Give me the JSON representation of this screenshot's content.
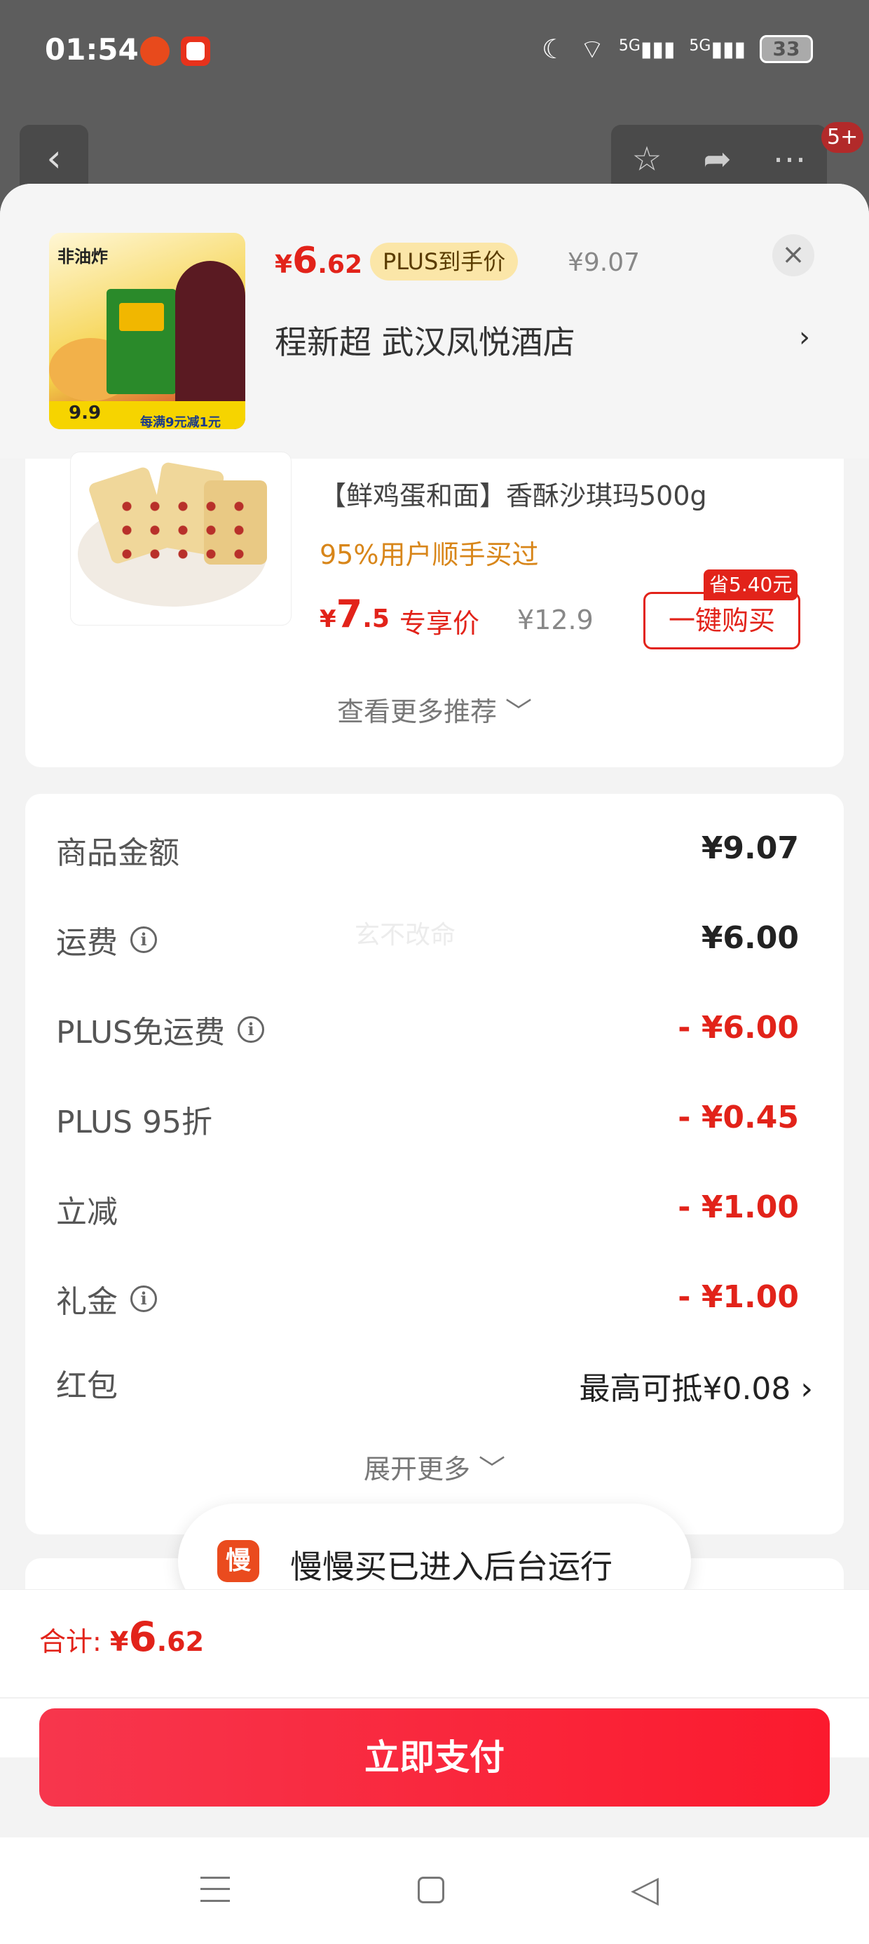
{
  "status_bar": {
    "time": "01:54",
    "battery": "33",
    "network": [
      "5G",
      "5G"
    ],
    "icons": [
      "moon-icon",
      "wifi-icon",
      "signal-icon",
      "signal-icon"
    ]
  },
  "background": {
    "badge": "5+"
  },
  "header": {
    "price_symbol": "¥",
    "price_int": "6",
    "price_dec": ".62",
    "plus_tag": "PLUS到手价",
    "original_price": "¥9.07",
    "close_label": "×",
    "hotel": "程新超  武汉凤悦酒店",
    "arrow": "›",
    "thumb_title": "非油炸",
    "thumb_price": "9.9",
    "thumb_promo": "每满9元减1元"
  },
  "recommendation": {
    "title": "【鲜鸡蛋和面】香酥沙琪玛500g",
    "social_proof": "95%用户顺手买过",
    "price_symbol": "¥",
    "price_int": "7",
    "price_dec": ".5",
    "exclusive_label": "专享价",
    "original_price": "¥12.9",
    "save_tag": "省5.40元",
    "buy_button": "一键购买",
    "more": "查看更多推荐 ﹀"
  },
  "fees": {
    "rows": [
      {
        "label": "商品金额",
        "value": "¥9.07"
      },
      {
        "label": "运费",
        "value": "¥6.00"
      },
      {
        "label": "PLUS免运费",
        "value": "- ¥6.00"
      },
      {
        "label": "PLUS 95折",
        "value": "- ¥0.45"
      },
      {
        "label": "立减",
        "value": "- ¥1.00"
      },
      {
        "label": "礼金",
        "value": "- ¥1.00"
      },
      {
        "label": "红包",
        "value": "最高可抵¥0.08  ›"
      }
    ],
    "watermark": "玄不改命",
    "expand_more": "展开更多 ﹀"
  },
  "toast": {
    "icon_char": "慢",
    "text": "慢慢买已进入后台运行"
  },
  "pay": {
    "total_label": "合计: ",
    "total_symbol": "¥",
    "total_int": "6",
    "total_dec": ".62",
    "button": "立即支付"
  },
  "colors": {
    "accent_red": "#e2231a",
    "orange": "#d8861a",
    "plus_bg": "#fbe6a8"
  }
}
